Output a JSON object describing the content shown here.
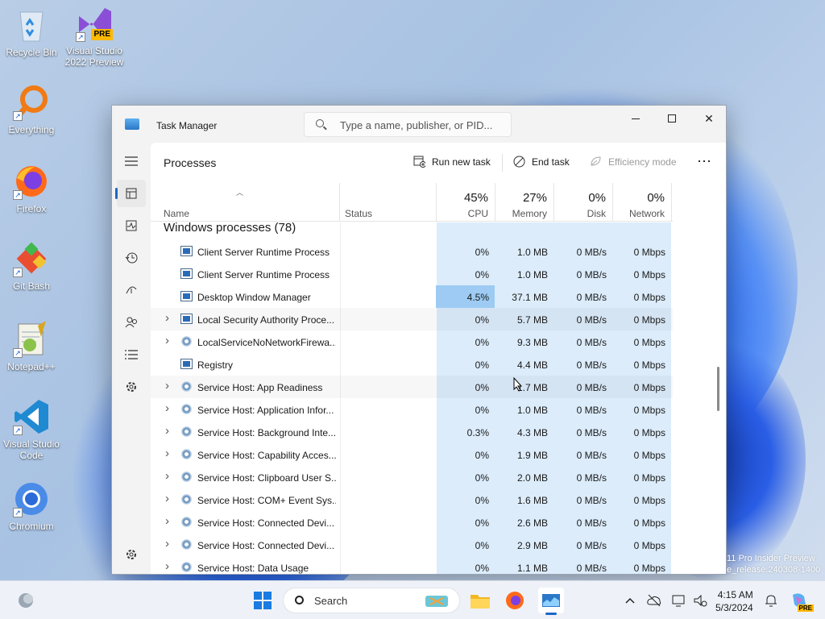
{
  "desktop": {
    "icons": [
      {
        "label": "Recycle Bin"
      },
      {
        "label": "Visual Studio 2022 Preview",
        "badge": "PRE"
      },
      {
        "label": "Everything"
      },
      {
        "label": "Firefox"
      },
      {
        "label": "Git Bash"
      },
      {
        "label": "Notepad++"
      },
      {
        "label": "Visual Studio Code"
      },
      {
        "label": "Chromium"
      }
    ],
    "watermark_line1": "11 Pro Insider Preview",
    "watermark_line2": "e_release.240308-1400"
  },
  "window": {
    "title": "Task Manager",
    "search_placeholder": "Type a name, publisher, or PID...",
    "page_title": "Processes",
    "toolbar": {
      "run_new_task": "Run new task",
      "end_task": "End task",
      "efficiency_mode": "Efficiency mode",
      "more": "⋯"
    },
    "columns": {
      "name": "Name",
      "status": "Status",
      "cpu_pct": "45%",
      "cpu": "CPU",
      "memory_pct": "27%",
      "memory": "Memory",
      "disk_pct": "0%",
      "disk": "Disk",
      "network_pct": "0%",
      "network": "Network"
    },
    "group_label": "Windows processes (78)",
    "rows": [
      {
        "name": "Client Server Runtime Process",
        "expand": false,
        "icon": "window-icon",
        "cpu": "0%",
        "memory": "1.0 MB",
        "disk": "0 MB/s",
        "network": "0 Mbps"
      },
      {
        "name": "Client Server Runtime Process",
        "expand": false,
        "icon": "window-icon",
        "cpu": "0%",
        "memory": "1.0 MB",
        "disk": "0 MB/s",
        "network": "0 Mbps"
      },
      {
        "name": "Desktop Window Manager",
        "expand": false,
        "icon": "window-icon",
        "cpu": "4.5%",
        "memory": "37.1 MB",
        "disk": "0 MB/s",
        "network": "0 Mbps",
        "cpu_hot": true
      },
      {
        "name": "Local Security Authority Proce...",
        "expand": true,
        "icon": "window-icon",
        "cpu": "0%",
        "memory": "5.7 MB",
        "disk": "0 MB/s",
        "network": "0 Mbps",
        "hover": true
      },
      {
        "name": "LocalServiceNoNetworkFirewa...",
        "expand": true,
        "icon": "gear-icon",
        "cpu": "0%",
        "memory": "9.3 MB",
        "disk": "0 MB/s",
        "network": "0 Mbps"
      },
      {
        "name": "Registry",
        "expand": false,
        "icon": "window-icon",
        "cpu": "0%",
        "memory": "4.4 MB",
        "disk": "0 MB/s",
        "network": "0 Mbps"
      },
      {
        "name": "Service Host: App Readiness",
        "expand": true,
        "icon": "gear-icon",
        "cpu": "0%",
        "memory": "1.7 MB",
        "disk": "0 MB/s",
        "network": "0 Mbps",
        "hover": true
      },
      {
        "name": "Service Host: Application Infor...",
        "expand": true,
        "icon": "gear-icon",
        "cpu": "0%",
        "memory": "1.0 MB",
        "disk": "0 MB/s",
        "network": "0 Mbps"
      },
      {
        "name": "Service Host: Background Inte...",
        "expand": true,
        "icon": "gear-icon",
        "cpu": "0.3%",
        "memory": "4.3 MB",
        "disk": "0 MB/s",
        "network": "0 Mbps"
      },
      {
        "name": "Service Host: Capability Acces...",
        "expand": true,
        "icon": "gear-icon",
        "cpu": "0%",
        "memory": "1.9 MB",
        "disk": "0 MB/s",
        "network": "0 Mbps"
      },
      {
        "name": "Service Host: Clipboard User S...",
        "expand": true,
        "icon": "gear-icon",
        "cpu": "0%",
        "memory": "2.0 MB",
        "disk": "0 MB/s",
        "network": "0 Mbps"
      },
      {
        "name": "Service Host: COM+ Event Sys...",
        "expand": true,
        "icon": "gear-icon",
        "cpu": "0%",
        "memory": "1.6 MB",
        "disk": "0 MB/s",
        "network": "0 Mbps"
      },
      {
        "name": "Service Host: Connected Devi...",
        "expand": true,
        "icon": "gear-icon",
        "cpu": "0%",
        "memory": "2.6 MB",
        "disk": "0 MB/s",
        "network": "0 Mbps"
      },
      {
        "name": "Service Host: Connected Devi...",
        "expand": true,
        "icon": "gear-icon",
        "cpu": "0%",
        "memory": "2.9 MB",
        "disk": "0 MB/s",
        "network": "0 Mbps"
      },
      {
        "name": "Service Host: Data Usage",
        "expand": true,
        "icon": "gear-icon",
        "cpu": "0%",
        "memory": "1.1 MB",
        "disk": "0 MB/s",
        "network": "0 Mbps"
      }
    ]
  },
  "taskbar": {
    "search_label": "Search",
    "time": "4:15 AM",
    "date": "5/3/2024"
  },
  "colors": {
    "accent": "#1a68c7",
    "column_highlight": "#dcecfb",
    "cpu_hot": "#9dcbf3"
  }
}
